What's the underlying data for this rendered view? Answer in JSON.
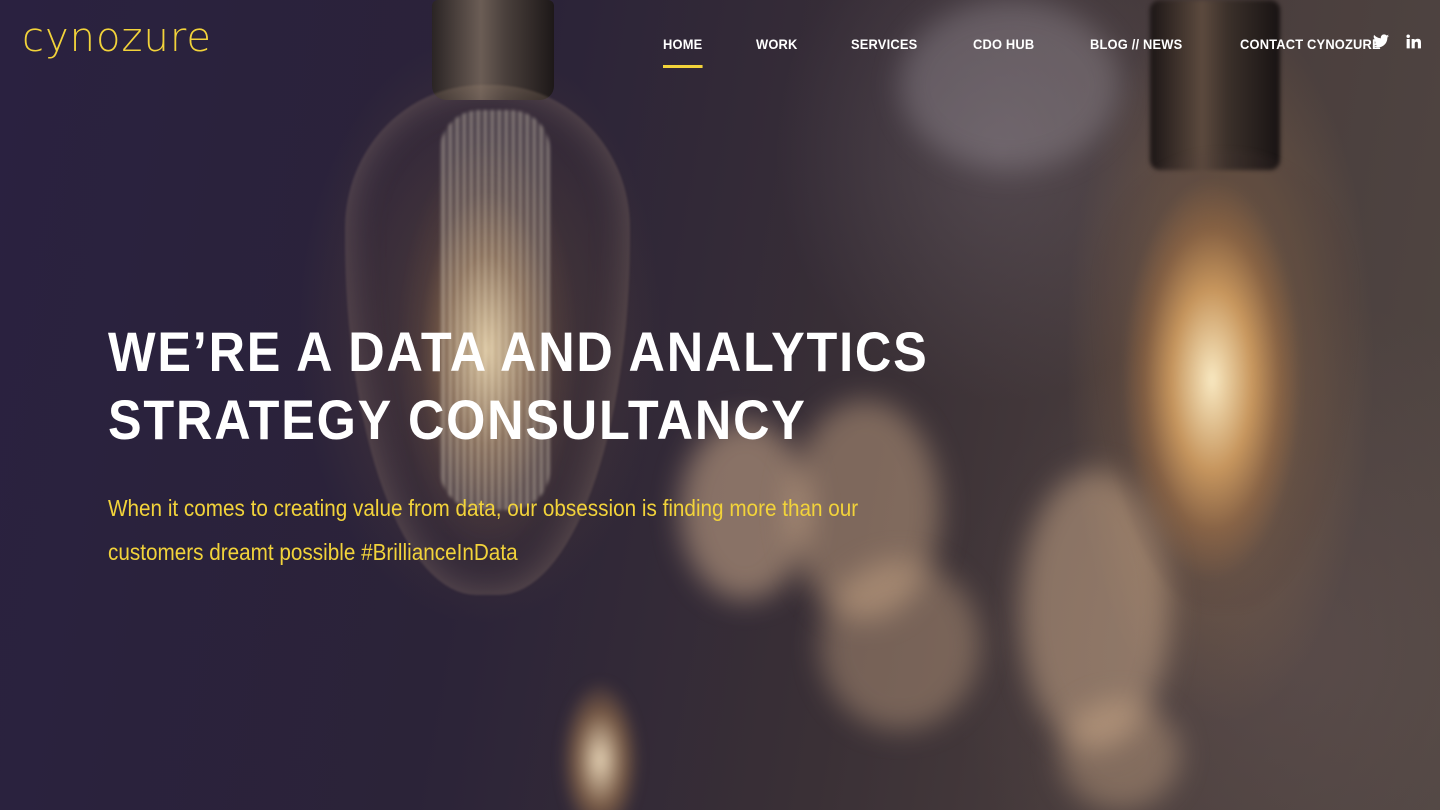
{
  "brand": {
    "logo_text": "cynozure",
    "accent_color": "#f2d33a"
  },
  "nav": {
    "items": [
      {
        "label": "HOME",
        "active": true
      },
      {
        "label": "WORK",
        "active": false
      },
      {
        "label": "SERVICES",
        "active": false
      },
      {
        "label": "CDO HUB",
        "active": false
      },
      {
        "label": "BLOG // NEWS",
        "active": false
      },
      {
        "label": "CONTACT CYNOZURE",
        "active": false
      }
    ]
  },
  "social": {
    "icons": [
      "twitter-icon",
      "linkedin-icon"
    ]
  },
  "hero": {
    "title_line1": "WE’RE A DATA AND ANALYTICS",
    "title_line2": "STRATEGY CONSULTANCY",
    "subtitle_line1": "When it comes to creating value from data, our obsession is finding more than our",
    "subtitle_line2": "customers dreamt possible #BrillianceInData",
    "background_image": "edison-light-bulbs-icon"
  }
}
